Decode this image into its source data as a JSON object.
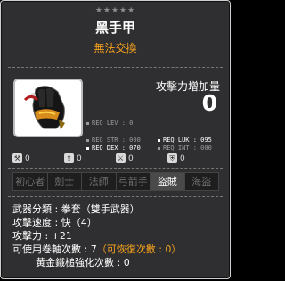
{
  "item": {
    "stars": "★★★★★",
    "name": "黑手甲",
    "untradeable": "無法交換",
    "attack_label": "攻擊力增加量",
    "attack_value": "0"
  },
  "requirements": {
    "lev": "REQ LEV :",
    "lev_val": "0",
    "str": "REQ STR :",
    "str_val": "000",
    "dex": "REQ DEX :",
    "dex_val": "070",
    "luk": "REQ LUK :",
    "luk_val": "095",
    "int": "REQ INT :",
    "int_val": "000"
  },
  "badges": [
    {
      "icon": "wrench-icon",
      "value": "0"
    },
    {
      "icon": "upload-icon",
      "value": "0"
    },
    {
      "icon": "sword-icon",
      "value": "0"
    },
    {
      "icon": "shield-icon",
      "value": "0"
    }
  ],
  "jobs": [
    {
      "label": "初心者",
      "active": false
    },
    {
      "label": "劍士",
      "active": false
    },
    {
      "label": "法師",
      "active": false
    },
    {
      "label": "弓箭手",
      "active": false
    },
    {
      "label": "盜賊",
      "active": true
    },
    {
      "label": "海盜",
      "active": false
    }
  ],
  "stats": {
    "weapon_type": "武器分類 : 拳套（雙手武器）",
    "attack_speed": "攻擊速度 : 快（4）",
    "attack": "攻擊力 : +21",
    "scrolls_prefix": "可使用卷軸次數 : 7",
    "scrolls_recover": "（可恢復次數 : 0）",
    "hammer": "黃金鐵槌強化次數 : 0"
  },
  "colors": {
    "accent_orange": "#f6a21d",
    "background": "#2f2f31"
  }
}
